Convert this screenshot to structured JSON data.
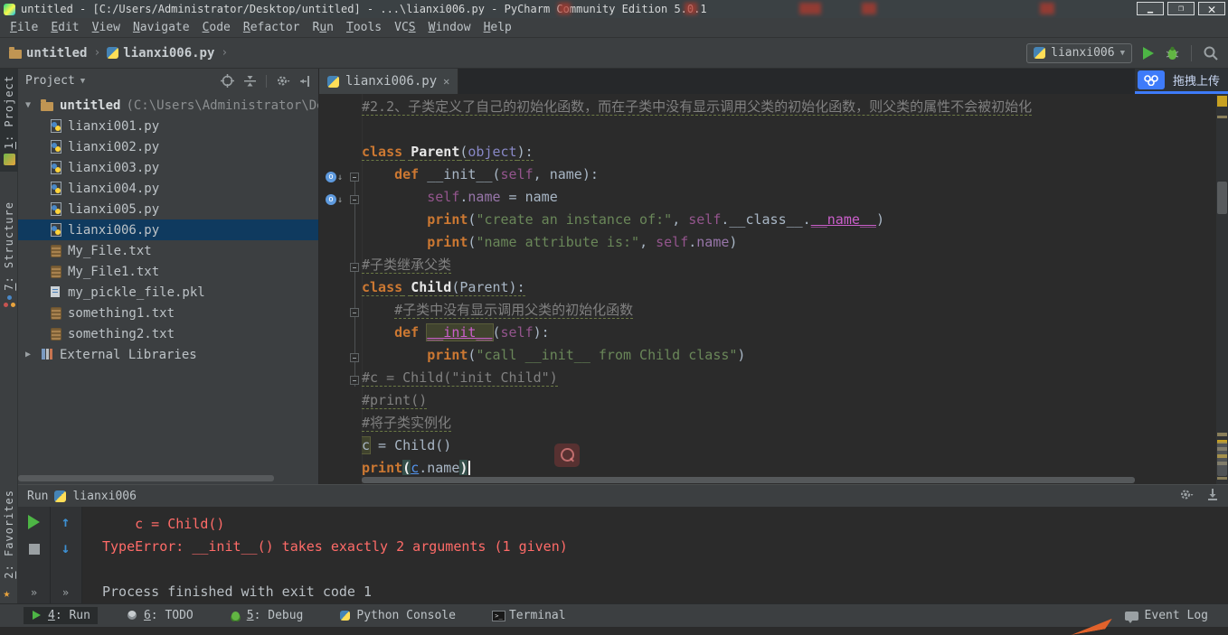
{
  "titlebar": {
    "title": "untitled - [C:/Users/Administrator/Desktop/untitled] - ...\\lianxi006.py - PyCharm Community Edition 5.0.1"
  },
  "menu": {
    "items": [
      {
        "pre": "",
        "u": "F",
        "post": "ile"
      },
      {
        "pre": "",
        "u": "E",
        "post": "dit"
      },
      {
        "pre": "",
        "u": "V",
        "post": "iew"
      },
      {
        "pre": "",
        "u": "N",
        "post": "avigate"
      },
      {
        "pre": "",
        "u": "C",
        "post": "ode"
      },
      {
        "pre": "",
        "u": "R",
        "post": "efactor"
      },
      {
        "pre": "R",
        "u": "u",
        "post": "n"
      },
      {
        "pre": "",
        "u": "T",
        "post": "ools"
      },
      {
        "pre": "VC",
        "u": "S",
        "post": ""
      },
      {
        "pre": "",
        "u": "W",
        "post": "indow"
      },
      {
        "pre": "",
        "u": "H",
        "post": "elp"
      }
    ]
  },
  "toolbar": {
    "breadcrumb_root": "untitled",
    "breadcrumb_file": "lianxi006.py",
    "run_config": "lianxi006"
  },
  "overlay": {
    "upload_label": "拖拽上传"
  },
  "leftbar": {
    "top": [
      {
        "u": "1",
        "rest": ": Project",
        "icon": "project",
        "cls": "active"
      },
      {
        "u": "7",
        "rest": ": Structure",
        "icon": "structure",
        "cls": "gap"
      }
    ],
    "bottom": [
      {
        "u": "2",
        "rest": ": Favorites",
        "icon": "star",
        "cls": ""
      }
    ]
  },
  "project": {
    "title": "Project",
    "root_name": "untitled",
    "root_path": "(C:\\Users\\Administrator\\De",
    "files": [
      {
        "name": "lianxi001.py",
        "type": "python",
        "cls": ""
      },
      {
        "name": "lianxi002.py",
        "type": "python",
        "cls": ""
      },
      {
        "name": "lianxi003.py",
        "type": "python",
        "cls": ""
      },
      {
        "name": "lianxi004.py",
        "type": "python",
        "cls": ""
      },
      {
        "name": "lianxi005.py",
        "type": "python",
        "cls": ""
      },
      {
        "name": "lianxi006.py",
        "type": "python",
        "cls": "selected"
      },
      {
        "name": "My_File.txt",
        "type": "scroll",
        "cls": ""
      },
      {
        "name": "My_File1.txt",
        "type": "scroll",
        "cls": ""
      },
      {
        "name": "my_pickle_file.pkl",
        "type": "plain",
        "cls": ""
      },
      {
        "name": "something1.txt",
        "type": "scroll",
        "cls": ""
      },
      {
        "name": "something2.txt",
        "type": "scroll",
        "cls": ""
      }
    ],
    "external": "External Libraries"
  },
  "editor": {
    "tab": "lianxi006.py",
    "lines": [
      {
        "tokens": [
          {
            "t": "#2.2、子类定义了自己的初始化函数，而在子类中没有显示调用父类的初始化函数，则父类的属性不会被初始化",
            "c": "com wavy"
          }
        ]
      },
      {
        "tokens": []
      },
      {
        "tokens": [
          {
            "t": "class",
            "c": "kw wavy"
          },
          {
            "t": " ",
            "c": "wavy"
          },
          {
            "t": "Parent",
            "c": "cls wavy"
          },
          {
            "t": "(",
            "c": "wavy"
          },
          {
            "t": "object",
            "c": "pur wavy"
          },
          {
            "t": "):",
            "c": "wavy"
          }
        ]
      },
      {
        "tokens": [
          {
            "t": "    ",
            "c": ""
          },
          {
            "t": "def",
            "c": "kw"
          },
          {
            "t": " __init__(",
            "c": ""
          },
          {
            "t": "self",
            "c": "slf"
          },
          {
            "t": ", name):",
            "c": ""
          }
        ]
      },
      {
        "tokens": [
          {
            "t": "        ",
            "c": ""
          },
          {
            "t": "self",
            "c": "slf"
          },
          {
            "t": ".",
            "c": ""
          },
          {
            "t": "name",
            "c": "attr"
          },
          {
            "t": " = name",
            "c": ""
          }
        ]
      },
      {
        "tokens": [
          {
            "t": "        ",
            "c": ""
          },
          {
            "t": "print",
            "c": "kw"
          },
          {
            "t": "(",
            "c": ""
          },
          {
            "t": "\"create an instance of:\"",
            "c": "str"
          },
          {
            "t": ", ",
            "c": ""
          },
          {
            "t": "self",
            "c": "slf"
          },
          {
            "t": ".__class__.",
            "c": ""
          },
          {
            "t": "__name__",
            "c": "mag"
          },
          {
            "t": ")",
            "c": ""
          }
        ]
      },
      {
        "tokens": [
          {
            "t": "        ",
            "c": ""
          },
          {
            "t": "print",
            "c": "kw"
          },
          {
            "t": "(",
            "c": ""
          },
          {
            "t": "\"name attribute is:\"",
            "c": "str"
          },
          {
            "t": ", ",
            "c": ""
          },
          {
            "t": "self",
            "c": "slf"
          },
          {
            "t": ".",
            "c": ""
          },
          {
            "t": "name",
            "c": "attr"
          },
          {
            "t": ")",
            "c": ""
          }
        ]
      },
      {
        "tokens": [
          {
            "t": "#子类继承父类",
            "c": "com wavy"
          }
        ]
      },
      {
        "tokens": [
          {
            "t": "class",
            "c": "kw wavy"
          },
          {
            "t": " ",
            "c": "wavy"
          },
          {
            "t": "Child",
            "c": "cls wavy"
          },
          {
            "t": "(Parent):",
            "c": "wavy"
          }
        ]
      },
      {
        "tokens": [
          {
            "t": "    ",
            "c": ""
          },
          {
            "t": "#子类中没有显示调用父类的初始化函数",
            "c": "com wavy"
          }
        ]
      },
      {
        "tokens": [
          {
            "t": "    ",
            "c": ""
          },
          {
            "t": "def",
            "c": "kw"
          },
          {
            "t": " ",
            "c": ""
          },
          {
            "t": "__init__",
            "c": "mag hlbox"
          },
          {
            "t": "(",
            "c": ""
          },
          {
            "t": "self",
            "c": "slf"
          },
          {
            "t": "):",
            "c": ""
          }
        ]
      },
      {
        "tokens": [
          {
            "t": "        ",
            "c": ""
          },
          {
            "t": "print",
            "c": "kw"
          },
          {
            "t": "(",
            "c": ""
          },
          {
            "t": "\"call __init__ from Child class\"",
            "c": "str"
          },
          {
            "t": ")",
            "c": ""
          }
        ]
      },
      {
        "tokens": [
          {
            "t": "#c = Child(\"init Child\")",
            "c": "com wavy"
          }
        ]
      },
      {
        "tokens": [
          {
            "t": "#print()",
            "c": "com wavy"
          }
        ]
      },
      {
        "tokens": [
          {
            "t": "#将子类实例化",
            "c": "com wavy"
          }
        ]
      },
      {
        "tokens": [
          {
            "t": "c",
            "c": "hlbox"
          },
          {
            "t": " = Child()",
            "c": ""
          }
        ]
      },
      {
        "tokens": [
          {
            "t": "print",
            "c": "kw"
          },
          {
            "t": "(",
            "c": "match"
          },
          {
            "t": "c",
            "c": "link"
          },
          {
            "t": ".name",
            "c": ""
          },
          {
            "t": ")",
            "c": "match"
          },
          {
            "t": "",
            "c": "caret"
          }
        ]
      }
    ]
  },
  "run": {
    "tab_label": "Run",
    "process": "lianxi006",
    "output": [
      {
        "t": "    c = Child()",
        "c": "err"
      },
      {
        "t": "TypeError: __init__() takes exactly 2 arguments (1 given)",
        "c": "err"
      },
      {
        "t": "",
        "c": "out"
      },
      {
        "t": "Process finished with exit code 1",
        "c": "out"
      }
    ]
  },
  "status": {
    "items": [
      {
        "u": "4",
        "rest": ": Run",
        "icon": "run",
        "cls": "active"
      },
      {
        "u": "6",
        "rest": ": TODO",
        "icon": "todo",
        "cls": ""
      },
      {
        "u": "5",
        "rest": ": Debug",
        "icon": "debug",
        "cls": ""
      },
      {
        "u": "",
        "rest": "Python Console",
        "icon": "pycon",
        "cls": ""
      },
      {
        "u": "",
        "rest": "Terminal",
        "icon": "term",
        "cls": ""
      }
    ],
    "event_log": "Event Log"
  },
  "colors": {
    "accent_blue": "#3e7bfa",
    "error_red": "#ff6b68",
    "keyword_orange": "#cc7832",
    "string_green": "#6a8759",
    "selection_blue": "#0f3a5f"
  }
}
